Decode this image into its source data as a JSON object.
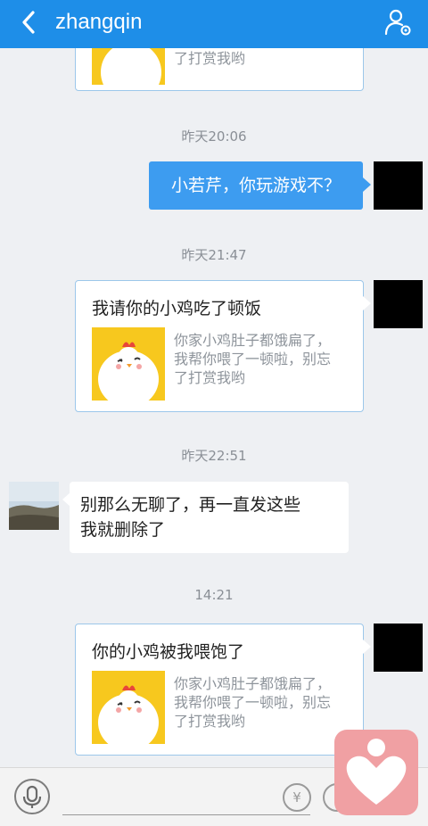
{
  "header": {
    "title": "zhangqin"
  },
  "timestamps": [
    "昨天20:06",
    "昨天21:47",
    "昨天22:51",
    "14:21"
  ],
  "messages": {
    "partial_card": {
      "desc_line": "了打赏我哟"
    },
    "blue_bubble": {
      "text": "小若芹，你玩游戏不？"
    },
    "card1": {
      "title": "我请你的小鸡吃了顿饭",
      "desc_lines": [
        "你家小鸡肚子都饿扁了，",
        "我帮你喂了一顿啦，别忘",
        "了打赏我哟"
      ]
    },
    "white_bubble": {
      "lines": [
        "别那么无聊了，再一直发这些",
        "我就删除了"
      ]
    },
    "card2": {
      "title": "你的小鸡被我喂饱了",
      "desc_lines": [
        "你家小鸡肚子都饿扁了，",
        "我帮你喂了一顿啦，别忘",
        "了打赏我哟"
      ]
    }
  },
  "bottom_bar": {
    "yen_symbol": "¥"
  },
  "icons": [
    "back-arrow-icon",
    "profile-settings-icon",
    "microphone-icon",
    "yen-icon",
    "emoji-icon",
    "heart-icon",
    "chick-icon"
  ],
  "colors": {
    "header": "#1e8ee8",
    "blue_bubble": "#3d9cf0",
    "card_border": "#9cc7ea",
    "heart_badge": "#f0a0a3"
  }
}
